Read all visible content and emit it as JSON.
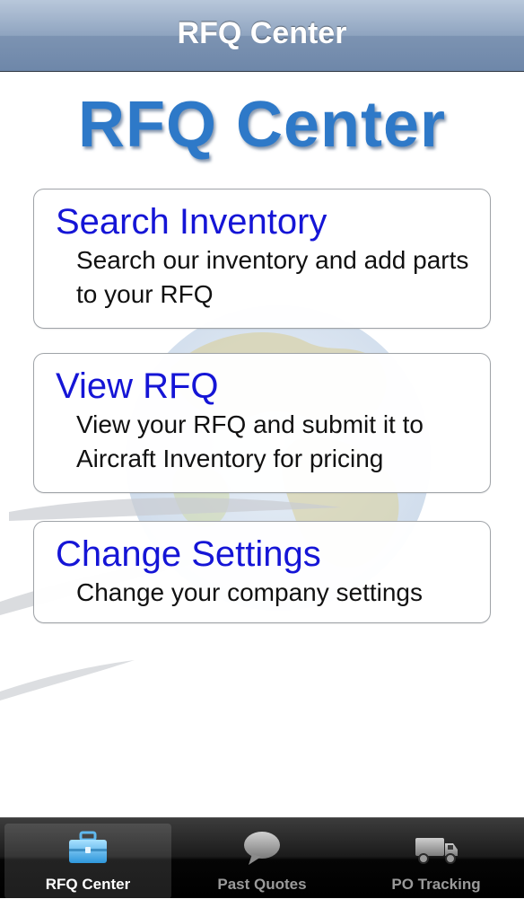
{
  "navbar": {
    "title": "RFQ Center"
  },
  "header": {
    "logo_text": "RFQ Center"
  },
  "menu": [
    {
      "title": "Search Inventory",
      "description": "Search our inventory and add parts to your RFQ"
    },
    {
      "title": "View RFQ",
      "description": "View your RFQ and submit it to Aircraft Inventory for pricing"
    },
    {
      "title": "Change Settings",
      "description": "Change your company settings"
    }
  ],
  "tabbar": {
    "tabs": [
      {
        "label": "RFQ Center",
        "icon": "toolbox-icon",
        "selected": true
      },
      {
        "label": "Past Quotes",
        "icon": "speech-bubble-icon",
        "selected": false
      },
      {
        "label": "PO Tracking",
        "icon": "truck-icon",
        "selected": false
      }
    ]
  },
  "colors": {
    "link_blue": "#1515d6",
    "logo_blue": "#2e79c8",
    "tint_selected": "#4fb6ef"
  }
}
